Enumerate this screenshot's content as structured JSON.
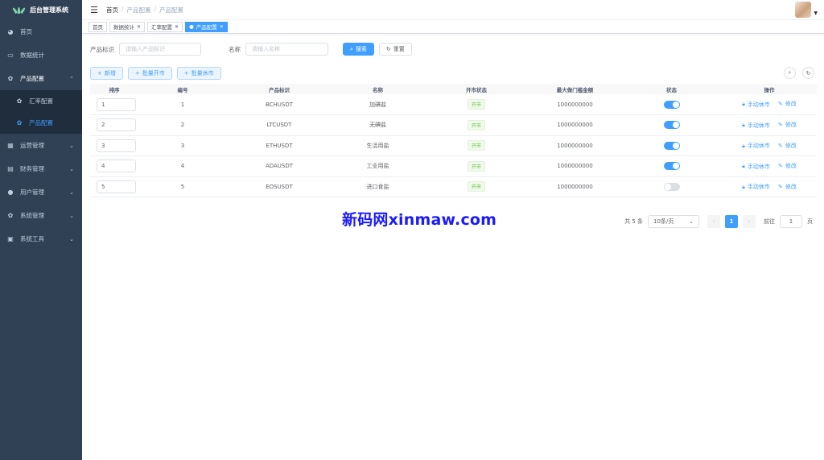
{
  "app": {
    "title": "后台管理系统"
  },
  "sidebar": {
    "items": [
      {
        "label": "首页",
        "icon": "dashboard-icon"
      },
      {
        "label": "数据统计",
        "icon": "monitor-icon"
      },
      {
        "label": "产品配置",
        "icon": "gear-icon",
        "open": true,
        "children": [
          {
            "label": "汇率配置",
            "icon": "gear-icon"
          },
          {
            "label": "产品配置",
            "icon": "gear-icon",
            "active": true
          }
        ]
      },
      {
        "label": "运营管理",
        "icon": "grid-icon"
      },
      {
        "label": "财务管理",
        "icon": "book-icon"
      },
      {
        "label": "用户管理",
        "icon": "user-icon"
      },
      {
        "label": "系统管理",
        "icon": "gear-icon"
      },
      {
        "label": "系统工具",
        "icon": "toolbox-icon"
      }
    ]
  },
  "breadcrumb": [
    "首页",
    "产品配置",
    "产品配置"
  ],
  "tabs": [
    {
      "label": "首页",
      "closable": false
    },
    {
      "label": "数据统计",
      "closable": true
    },
    {
      "label": "汇率配置",
      "closable": true
    },
    {
      "label": "产品配置",
      "closable": true,
      "active": true
    }
  ],
  "search": {
    "product_label": "产品标识",
    "product_placeholder": "请输入产品标识",
    "name_label": "名称",
    "name_placeholder": "请输入名称",
    "search_btn": "搜索",
    "reset_btn": "重置"
  },
  "toolbar": {
    "add": "新增",
    "open": "批量开市",
    "close": "批量休市"
  },
  "table": {
    "headers": [
      "排序",
      "编号",
      "产品标识",
      "名称",
      "开市状态",
      "最大做门槛金额",
      "状态",
      "操作"
    ],
    "rows": [
      {
        "sort": "1",
        "id": "1",
        "symbol": "BCHUSDT",
        "name": "加碘盐",
        "market": "开市",
        "max": "1000000000",
        "enabled": true
      },
      {
        "sort": "2",
        "id": "2",
        "symbol": "LTCUSDT",
        "name": "无碘盐",
        "market": "开市",
        "max": "1000000000",
        "enabled": true
      },
      {
        "sort": "3",
        "id": "3",
        "symbol": "ETHUSDT",
        "name": "生活用盐",
        "market": "开市",
        "max": "1000000000",
        "enabled": true
      },
      {
        "sort": "4",
        "id": "4",
        "symbol": "ADAUSDT",
        "name": "工业用盐",
        "market": "开市",
        "max": "1000000000",
        "enabled": true
      },
      {
        "sort": "5",
        "id": "5",
        "symbol": "EOSUSDT",
        "name": "进口食盐",
        "market": "开市",
        "max": "1000000000",
        "enabled": false
      }
    ],
    "op_halt": "手动休市",
    "op_edit": "修改"
  },
  "pager": {
    "total": "共 5 条",
    "page_size": "10条/页",
    "current": "1",
    "goto_label": "前往",
    "goto_value": "1",
    "page_suffix": "页"
  },
  "watermark": "新码网xinmaw.com",
  "colors": {
    "sidebar": "#304156",
    "primary": "#409eff",
    "success": "#67c23a"
  }
}
